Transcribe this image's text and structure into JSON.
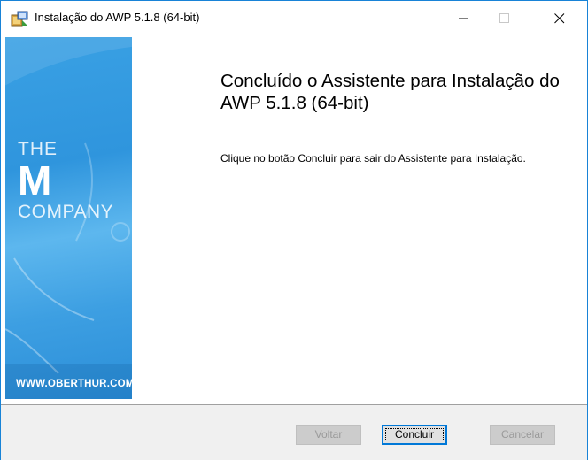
{
  "window": {
    "title": "Instalação do AWP 5.1.8 (64-bit)",
    "controls": {
      "minimize": "—",
      "maximize": "☐",
      "close": "✕"
    }
  },
  "banner": {
    "brand_the": "THE",
    "brand_m": "M",
    "brand_company": "COMPANY",
    "website": "WWW.OBERTHUR.COM"
  },
  "main": {
    "heading": "Concluído o Assistente para Instalação do AWP 5.1.8 (64-bit)",
    "description": "Clique no botão Concluir para sair do Assistente para Instalação."
  },
  "footer": {
    "back_label": "Voltar",
    "finish_label": "Concluir",
    "cancel_label": "Cancelar"
  },
  "colors": {
    "banner_blue": "#3aa1e4",
    "focus_blue": "#0078d7"
  }
}
